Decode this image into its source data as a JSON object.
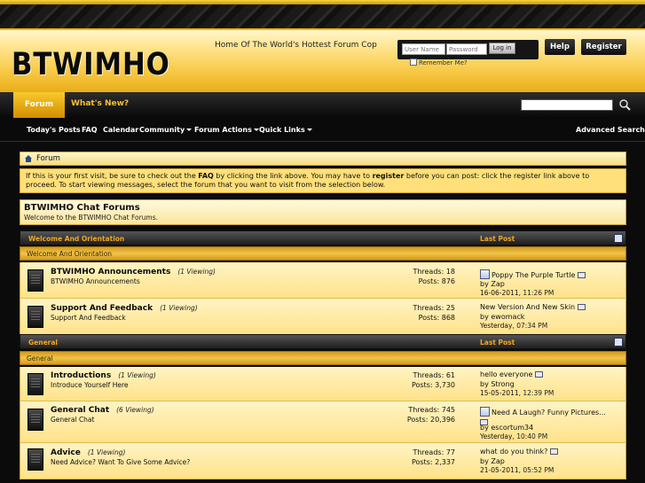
{
  "header": {
    "logo": "BTWIMHO",
    "tagline": "Home Of The World's Hottest Forum Cop",
    "username_placeholder": "User Name",
    "password_placeholder": "Password",
    "login_label": "Log in",
    "remember_label": "Remember Me?",
    "help_label": "Help",
    "register_label": "Register"
  },
  "navbar": {
    "tabs": [
      "Forum",
      "What's New?"
    ],
    "links": [
      "Today's Posts",
      "FAQ",
      "Calendar",
      "Community",
      "Forum Actions",
      "Quick Links"
    ],
    "advanced_search": "Advanced Search"
  },
  "breadcrumb": "Forum",
  "notice": {
    "p1": "If this is your first visit, be sure to check out the ",
    "faq": "FAQ",
    "p2": " by clicking the link above. You may have to ",
    "register": "register",
    "p3": " before you can post: click the register link above to proceed. To start viewing messages, select the forum that you want to visit from the selection below."
  },
  "forum_header": {
    "title": "BTWIMHO Chat Forums",
    "description": "Welcome to the BTWIMHO Chat Forums."
  },
  "categories": [
    {
      "name": "Welcome And Orientation",
      "last_post": "Last Post",
      "subtitle": "Welcome And Orientation"
    },
    {
      "name": "General",
      "last_post": "Last Post",
      "subtitle": "General"
    }
  ],
  "forums": [
    {
      "title": "BTWIMHO Announcements",
      "viewing": "(1 Viewing)",
      "desc": "BTWIMHO Announcements",
      "threads": "Threads: 18",
      "posts": "Posts: 876",
      "lp_title": "Poppy The Purple Turtle",
      "lp_by": "by Zap",
      "lp_date": "16-06-2011,",
      "lp_time": "11:26 PM"
    },
    {
      "title": "Support And Feedback",
      "viewing": "(1 Viewing)",
      "desc": "Support And Feedback",
      "threads": "Threads: 25",
      "posts": "Posts: 868",
      "lp_title": "New Version And New Skin",
      "lp_by": "by ewomack",
      "lp_date": "Yesterday,",
      "lp_time": "07:34 PM"
    },
    {
      "title": "Introductions",
      "viewing": "(1 Viewing)",
      "desc": "Introduce Yourself Here",
      "threads": "Threads: 61",
      "posts": "Posts: 3,730",
      "lp_title": "hello everyone",
      "lp_by": "by Strong",
      "lp_date": "15-05-2011,",
      "lp_time": "12:39 PM"
    },
    {
      "title": "General Chat",
      "viewing": "(6 Viewing)",
      "desc": "General Chat",
      "threads": "Threads: 745",
      "posts": "Posts: 20,396",
      "lp_title": "Need A Laugh? Funny Pictures...",
      "lp_by": "by escortum34",
      "lp_date": "Yesterday,",
      "lp_time": "10:40 PM"
    },
    {
      "title": "Advice",
      "viewing": "(1 Viewing)",
      "desc": "Need Advice? Want To Give Some Advice?",
      "threads": "Threads: 77",
      "posts": "Posts: 2,337",
      "lp_title": "what do you think?",
      "lp_by": "by Zap",
      "lp_date": "21-05-2011,",
      "lp_time": "05:52 PM"
    }
  ]
}
